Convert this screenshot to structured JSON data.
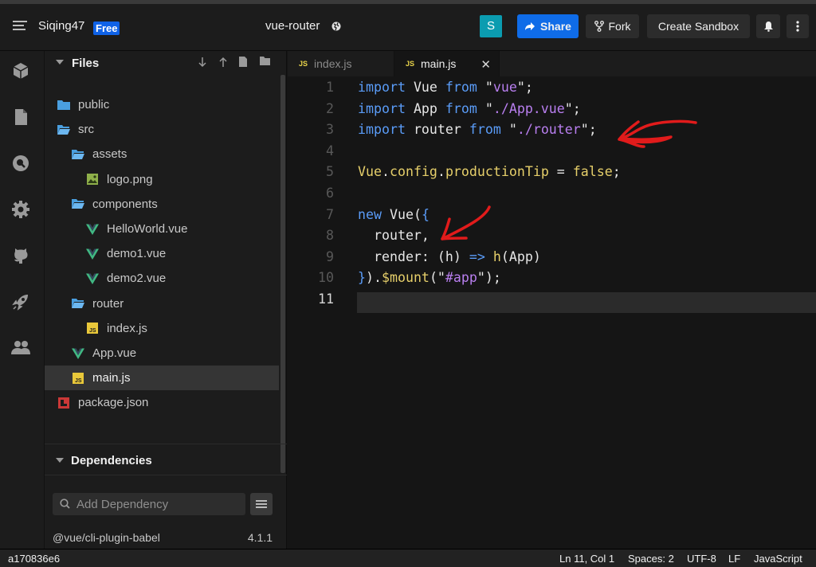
{
  "header": {
    "username": "Siqing47",
    "plan_badge": "Free",
    "project_title": "vue-router",
    "avatar_letter": "S",
    "share_label": "Share",
    "fork_label": "Fork",
    "create_label": "Create Sandbox"
  },
  "activity_bar": [
    "cube-icon",
    "file-icon",
    "search-icon",
    "gear-icon",
    "github-icon",
    "rocket-icon",
    "users-icon"
  ],
  "files": {
    "title": "Files",
    "tree": [
      {
        "label": "public",
        "type": "folder",
        "depth": 0
      },
      {
        "label": "src",
        "type": "folder-open",
        "depth": 0
      },
      {
        "label": "assets",
        "type": "folder-open",
        "depth": 1
      },
      {
        "label": "logo.png",
        "type": "image",
        "depth": 2
      },
      {
        "label": "components",
        "type": "folder-open",
        "depth": 1
      },
      {
        "label": "HelloWorld.vue",
        "type": "vue",
        "depth": 2
      },
      {
        "label": "demo1.vue",
        "type": "vue",
        "depth": 2
      },
      {
        "label": "demo2.vue",
        "type": "vue",
        "depth": 2
      },
      {
        "label": "router",
        "type": "folder-open",
        "depth": 1
      },
      {
        "label": "index.js",
        "type": "js",
        "depth": 2
      },
      {
        "label": "App.vue",
        "type": "vue",
        "depth": 1
      },
      {
        "label": "main.js",
        "type": "js",
        "depth": 1,
        "active": true
      },
      {
        "label": "package.json",
        "type": "npm",
        "depth": 0
      }
    ]
  },
  "dependencies": {
    "title": "Dependencies",
    "search_placeholder": "Add Dependency",
    "items": [
      {
        "name": "@vue/cli-plugin-babel",
        "version": "4.1.1"
      }
    ]
  },
  "tabs": [
    {
      "label": "index.js",
      "icon": "JS",
      "active": false
    },
    {
      "label": "main.js",
      "icon": "JS",
      "active": true
    }
  ],
  "editor": {
    "line_numbers": [
      "1",
      "2",
      "3",
      "4",
      "5",
      "6",
      "7",
      "8",
      "9",
      "10",
      "11"
    ],
    "current_line": "11",
    "lines": [
      [
        [
          "kw",
          "import"
        ],
        [
          "plain",
          " Vue "
        ],
        [
          "kw",
          "from"
        ],
        [
          "plain",
          " \""
        ],
        [
          "str",
          "vue"
        ],
        [
          "plain",
          "\";"
        ]
      ],
      [
        [
          "kw",
          "import"
        ],
        [
          "plain",
          " App "
        ],
        [
          "kw",
          "from"
        ],
        [
          "plain",
          " \""
        ],
        [
          "str",
          "./App.vue"
        ],
        [
          "plain",
          "\";"
        ]
      ],
      [
        [
          "kw",
          "import"
        ],
        [
          "plain",
          " router "
        ],
        [
          "kw",
          "from"
        ],
        [
          "plain",
          " \""
        ],
        [
          "str",
          "./router"
        ],
        [
          "plain",
          "\";"
        ]
      ],
      [],
      [
        [
          "tk",
          "Vue"
        ],
        [
          "plain",
          "."
        ],
        [
          "tk",
          "config"
        ],
        [
          "plain",
          "."
        ],
        [
          "tk",
          "productionTip"
        ],
        [
          "plain",
          " = "
        ],
        [
          "tk",
          "false"
        ],
        [
          "plain",
          ";"
        ]
      ],
      [],
      [
        [
          "kw",
          "new"
        ],
        [
          "plain",
          " Vue("
        ],
        [
          "kw",
          "{"
        ]
      ],
      [
        [
          "plain",
          "  router,"
        ]
      ],
      [
        [
          "plain",
          "  render: (h) "
        ],
        [
          "kw",
          "=>"
        ],
        [
          "plain",
          " "
        ],
        [
          "tk",
          "h"
        ],
        [
          "plain",
          "(App)"
        ]
      ],
      [
        [
          "kw",
          "}"
        ],
        [
          "plain",
          ")."
        ],
        [
          "tk",
          "$mount"
        ],
        [
          "plain",
          "(\""
        ],
        [
          "str",
          "#app"
        ],
        [
          "plain",
          "\");"
        ]
      ],
      []
    ]
  },
  "status": {
    "left": "a170836e6",
    "position": "Ln 11, Col 1",
    "spaces": "Spaces: 2",
    "encoding": "UTF-8",
    "eol": "LF",
    "language": "JavaScript"
  },
  "colors": {
    "accent": "#0f6ce8",
    "keyword": "#5a9cf8",
    "string": "#b97ff0",
    "token": "#e6cf6a",
    "annotation": "#e11b1b"
  }
}
